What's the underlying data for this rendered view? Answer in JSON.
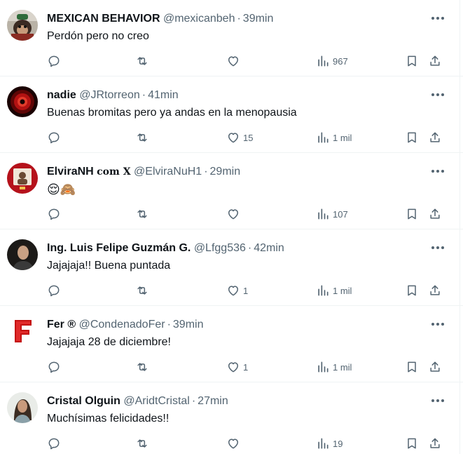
{
  "tweets": [
    {
      "name": "MEXICAN BEHAVIOR",
      "handle": "@mexicanbeh",
      "time": "39min",
      "text": "Perdón pero no creo",
      "likes": "",
      "views": "967",
      "avatar_icon": "monkey-avatar-icon"
    },
    {
      "name": "nadie",
      "handle": "@JRtorreon",
      "time": "41min",
      "text": "Buenas bromitas pero ya andas en la menopausia",
      "likes": "15",
      "views": "1 mil",
      "avatar_icon": "red-eye-avatar-icon"
    },
    {
      "name": "ElviraNH",
      "badge": "com X",
      "handle": "@ElviraNuH1",
      "time": "29min",
      "text": "😌🙈",
      "likes": "",
      "views": "107",
      "avatar_icon": "framed-photo-avatar-icon"
    },
    {
      "name": "Ing. Luis Felipe Guzmán G.",
      "handle": "@Lfgg536",
      "time": "42min",
      "text": "Jajajaja!! Buena puntada",
      "likes": "1",
      "views": "1 mil",
      "avatar_icon": "man-portrait-avatar-icon"
    },
    {
      "name": "Fer ®",
      "handle": "@CondenadoFer",
      "time": "39min",
      "text": "Jajajaja 28 de diciembre!",
      "likes": "1",
      "views": "1 mil",
      "avatar_icon": "red-f-logo-avatar-icon"
    },
    {
      "name": "Cristal Olguin",
      "handle": "@AridtCristal",
      "time": "27min",
      "text": "Muchísimas felicidades!!",
      "likes": "",
      "views": "19",
      "avatar_icon": "woman-portrait-avatar-icon"
    }
  ],
  "colors": {
    "text": "#0f1419",
    "secondary": "#536471",
    "divider": "#eff3f4"
  }
}
